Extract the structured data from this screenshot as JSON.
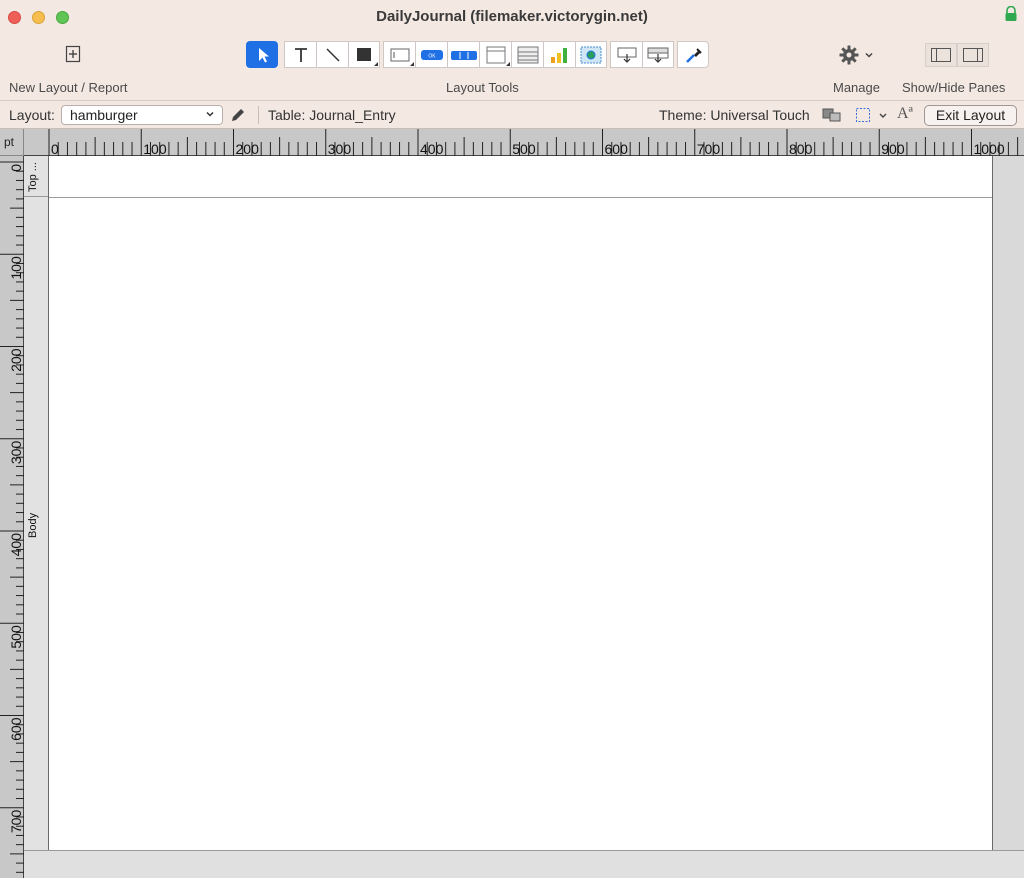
{
  "window": {
    "title": "DailyJournal (filemaker.victorygin.net)"
  },
  "toolbar": {
    "new_layout_label": "New Layout / Report",
    "layout_tools_label": "Layout Tools",
    "manage_label": "Manage",
    "panes_label": "Show/Hide Panes",
    "tools": [
      "select-arrow-icon",
      "text-tool-icon",
      "line-tool-icon",
      "rectangle-tool-icon",
      "field-tool-icon",
      "button-tool-icon",
      "button-bar-tool-icon",
      "popover-tool-icon",
      "portal-tool-icon",
      "chart-tool-icon",
      "web-viewer-tool-icon",
      "insert-field-icon",
      "insert-part-icon",
      "format-painter-icon"
    ],
    "active_tool": "select-arrow-icon",
    "button_tool_text": "OK"
  },
  "layout_bar": {
    "layout_label": "Layout:",
    "layout_value": "hamburger",
    "table_label": "Table: Journal_Entry",
    "theme_label": "Theme: Universal Touch",
    "exit_label": "Exit Layout",
    "text_format_glyph": "Aª"
  },
  "rulers": {
    "unit": "pt",
    "h_labels": [
      "0",
      "100",
      "200",
      "300",
      "400",
      "500",
      "600",
      "700",
      "800",
      "900",
      "1000"
    ],
    "v_labels": [
      "0",
      "100",
      "200",
      "300",
      "400",
      "500",
      "600",
      "700"
    ]
  },
  "parts": {
    "top_label": "Top ...",
    "body_label": "Body"
  },
  "colors": {
    "accent": "#1f6fe5",
    "chrome": "#f3e8e2",
    "ruler": "#c8c8c8"
  }
}
